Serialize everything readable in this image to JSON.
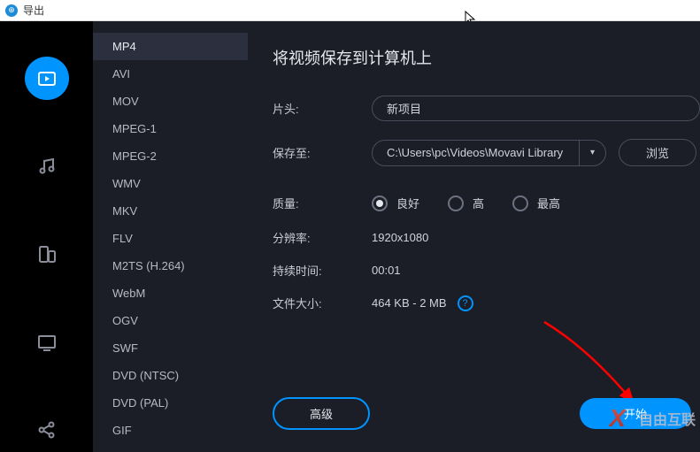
{
  "titlebar": {
    "text": "导出"
  },
  "iconbar": {
    "items": [
      {
        "name": "video-icon",
        "active": true
      },
      {
        "name": "music-icon",
        "active": false
      },
      {
        "name": "devices-icon",
        "active": false
      },
      {
        "name": "tv-icon",
        "active": false
      },
      {
        "name": "share-icon",
        "active": false
      }
    ]
  },
  "formats": [
    "MP4",
    "AVI",
    "MOV",
    "MPEG-1",
    "MPEG-2",
    "WMV",
    "MKV",
    "FLV",
    "M2TS (H.264)",
    "WebM",
    "OGV",
    "SWF",
    "DVD (NTSC)",
    "DVD (PAL)",
    "GIF"
  ],
  "format_selected": "MP4",
  "heading": "将视频保存到计算机上",
  "fields": {
    "title_label": "片头:",
    "title_value": "新项目",
    "save_label": "保存至:",
    "save_path": "C:\\Users\\pc\\Videos\\Movavi Library",
    "browse_label": "浏览",
    "quality_label": "质量:",
    "quality_options": [
      "良好",
      "高",
      "最高"
    ],
    "quality_selected": "良好",
    "res_label": "分辨率:",
    "res_value": "1920x1080",
    "dur_label": "持续时间:",
    "dur_value": "00:01",
    "size_label": "文件大小:",
    "size_value": "464 KB - 2 MB"
  },
  "buttons": {
    "advanced": "高级",
    "start": "开始"
  },
  "watermark": "自由互联"
}
